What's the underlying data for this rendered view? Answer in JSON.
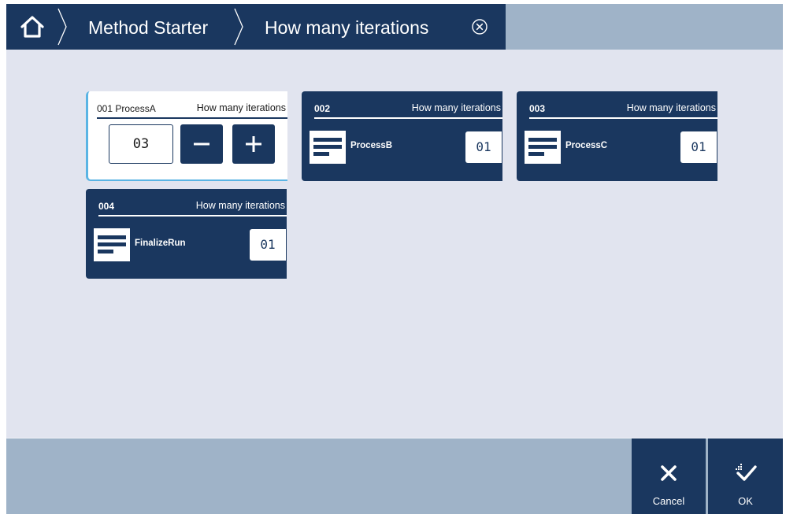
{
  "breadcrumb": {
    "home_icon": "home-icon",
    "items": [
      "Method Starter",
      "How many iterations"
    ],
    "close_icon": "close-circle-icon"
  },
  "cards": [
    {
      "id": "001 ProcessA",
      "caption": "How many iterations",
      "iterations": "03",
      "state": "editing",
      "decrement_icon": "minus-icon",
      "increment_icon": "plus-icon"
    },
    {
      "id": "002",
      "caption": "How many iterations",
      "name": "ProcessB",
      "iterations": "01",
      "icon": "document-lines-icon"
    },
    {
      "id": "003",
      "caption": "How many iterations",
      "name": "ProcessC",
      "iterations": "01",
      "icon": "document-lines-icon"
    },
    {
      "id": "004",
      "caption": "How many iterations",
      "name": "FinalizeRun",
      "iterations": "01",
      "icon": "document-lines-icon"
    }
  ],
  "footer": {
    "cancel_label": "Cancel",
    "cancel_icon": "close-icon",
    "ok_label": "OK",
    "ok_icon": "checkmark-icon"
  },
  "colors": {
    "navy": "#1a375f",
    "background": "#e1e4ef",
    "bar": "#9fb3c8",
    "focus_accent": "#5ab4e4"
  }
}
